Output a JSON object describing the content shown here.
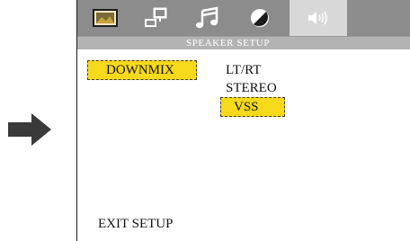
{
  "menu": {
    "tabs": [
      {
        "icon": "picture-icon",
        "active": false
      },
      {
        "icon": "screen-setup-icon",
        "active": false
      },
      {
        "icon": "music-note-icon",
        "active": false
      },
      {
        "icon": "contrast-icon",
        "active": false
      },
      {
        "icon": "speaker-icon",
        "active": true
      }
    ],
    "title": "SPEAKER SETUP"
  },
  "setting": {
    "label": "DOWNMIX"
  },
  "options": [
    "LT/RT",
    "STEREO",
    "VSS"
  ],
  "selected_option": "VSS",
  "exit_label": "EXIT SETUP",
  "colors": {
    "tab_bar": "#8c8c8c",
    "active_tab": "#d8d8d8",
    "title_bar": "#b3b3b3",
    "highlight": "#f6d91a",
    "arrow": "#3a3a3a"
  }
}
